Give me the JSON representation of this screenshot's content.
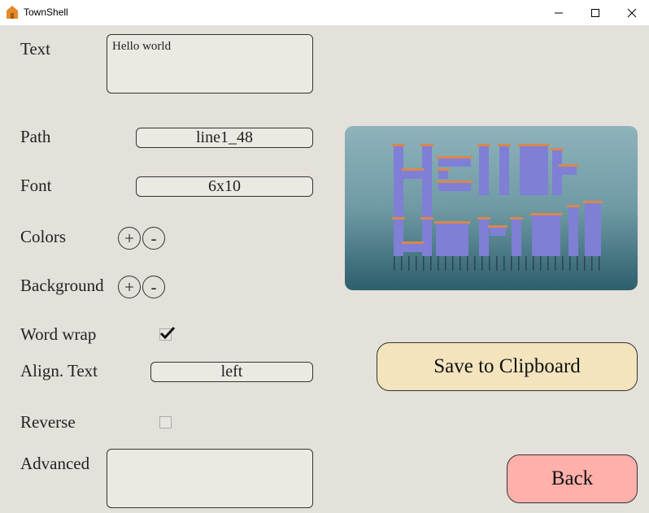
{
  "window": {
    "title": "TownShell",
    "minimize_glyph": "—",
    "maximize_glyph": "☐",
    "close_glyph": "✕"
  },
  "form": {
    "text_label": "Text",
    "text_value": "Hello world",
    "path_label": "Path",
    "path_value": "line1_48",
    "font_label": "Font",
    "font_value": "6x10",
    "colors_label": "Colors",
    "background_label": "Background",
    "plus": "+",
    "minus": "-",
    "word_wrap_label": "Word wrap",
    "word_wrap_checked": true,
    "align_label": "Align. Text",
    "align_value": "left",
    "reverse_label": "Reverse",
    "reverse_checked": false,
    "advanced_label": "Advanced",
    "advanced_value": ""
  },
  "preview": {
    "sky_color": "#6f9aa5",
    "building_color": "#7f7fd6",
    "roof_color": "#d8884e"
  },
  "actions": {
    "save_label": "Save to Clipboard",
    "save_color": "#f3e4bd",
    "back_label": "Back",
    "back_color": "#ffb0ab"
  }
}
